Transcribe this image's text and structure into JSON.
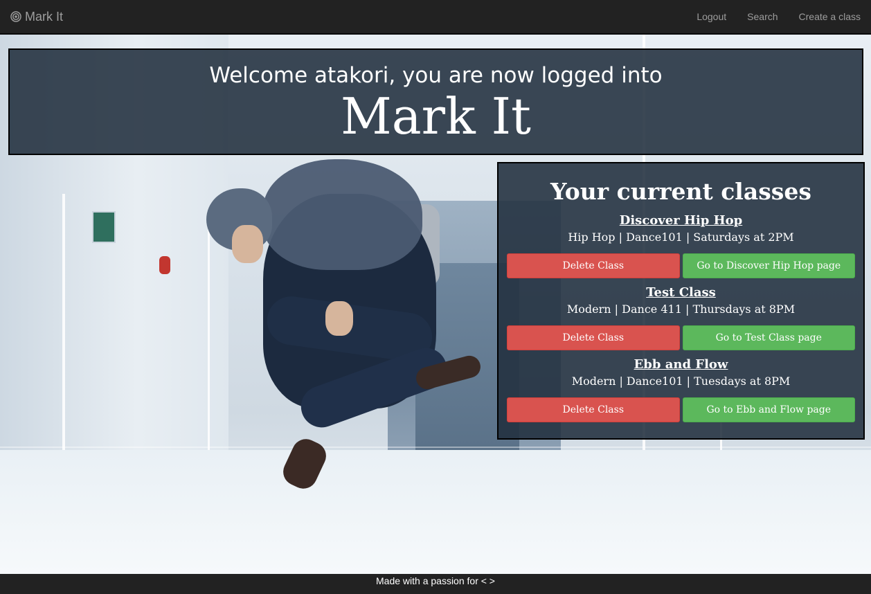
{
  "navbar": {
    "brand_label": "Mark It",
    "brand_icon": "target-icon",
    "links": [
      "Logout",
      "Search",
      "Create a class"
    ]
  },
  "welcome": {
    "line": "Welcome atakori, you are now logged into",
    "brand": "Mark It"
  },
  "classes": {
    "title": "Your current classes",
    "items": [
      {
        "name": "Discover Hip Hop",
        "info": "Hip Hop | Dance101 | Saturdays at 2PM",
        "delete_label": "Delete Class",
        "go_label": "Go to Discover Hip Hop page"
      },
      {
        "name": "Test Class",
        "info": "Modern | Dance 411 | Thursdays at 8PM",
        "delete_label": "Delete Class",
        "go_label": "Go to Test Class page"
      },
      {
        "name": "Ebb and Flow",
        "info": "Modern | Dance101 | Tuesdays at 8PM",
        "delete_label": "Delete Class",
        "go_label": "Go to Ebb and Flow page"
      }
    ]
  },
  "footer": {
    "text": "Made with a passion for < >"
  },
  "colors": {
    "navbar": "#222222",
    "panel": "#212f3d",
    "danger": "#d9534f",
    "success": "#5cb85c"
  }
}
